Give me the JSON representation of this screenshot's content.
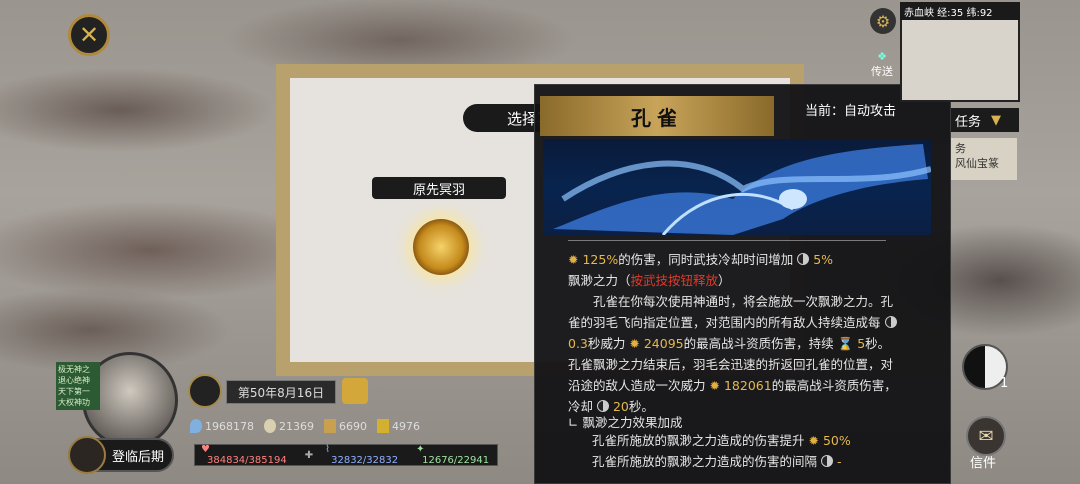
{
  "top_left": {
    "close_icon": "close-icon"
  },
  "skill_panel": {
    "select_banner": "选择冥羽",
    "name_tag": "原先冥羽"
  },
  "tooltip": {
    "title": "孔雀",
    "current_label": "当前：自动攻击",
    "line1_value": "125%",
    "line1_text": "的伤害，同时武技冷却时间增加",
    "line1_pct": "5%",
    "ability_name": "飘渺之力",
    "ability_hint": "按武技按钮释放",
    "desc1": "孔雀在你每次使用神通时，将会施放一次飘渺之力。孔雀的羽毛飞向指定位置，对范围内的所有敌人持续造成每",
    "desc1_interval": "0.3",
    "desc1_mid": "秒威力",
    "desc1_power": "24095",
    "desc1_end": "的最高战斗资质伤害，持续",
    "desc1_duration": "5",
    "desc2": "秒。孔雀飘渺之力结束后，羽毛会迅速的折返回孔雀的位置，对沿途的敌人造成一次威力",
    "desc2_power": "182061",
    "desc2_end": "的最高战斗资质伤害，冷却",
    "cooldown": "20",
    "cooldown_unit": "秒。",
    "bonus_header": "飘渺之力效果加成",
    "bonus1_text": "孔雀所施放的飘渺之力造成的伤害提升",
    "bonus1_value": "50%",
    "bonus2_text": "孔雀所施放的飘渺之力造成的伤害的间隔",
    "bonus2_value": "-"
  },
  "right_panel": {
    "minimap_title": "赤血峡 经:35 纬:92",
    "teleport_label": "传送",
    "task_label": "任务",
    "task_lines": [
      "务",
      "风仙宝篆"
    ],
    "yinyang_count": "1",
    "letter_label": "信件"
  },
  "player": {
    "statuses": [
      "极无神之",
      "退心绝神",
      "天下第一",
      "大权神功"
    ],
    "date": "第50年8月16日",
    "resources": [
      "1968178",
      "21369",
      "6690",
      "4976"
    ],
    "return_label": "登临后期",
    "hp": "384834/385194",
    "mp": "32832/32832",
    "sp": "12676/22941"
  },
  "colors": {
    "gold": "#e6b84c",
    "banner": "#c8a45a",
    "hint_red": "#e03a2a"
  }
}
